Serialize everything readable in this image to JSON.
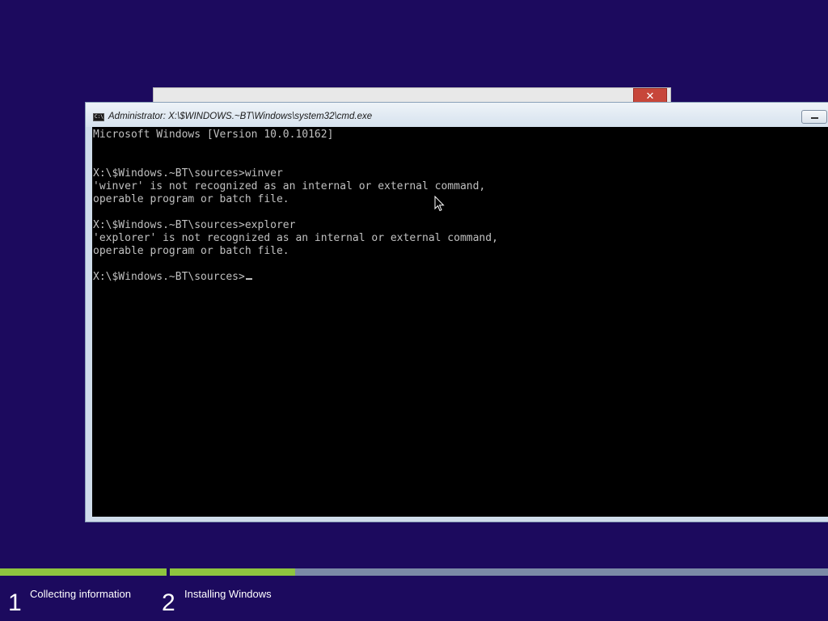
{
  "background_window": {
    "close_glyph": "✕"
  },
  "cmd_window": {
    "title": "Administrator: X:\\$WINDOWS.~BT\\Windows\\system32\\cmd.exe",
    "icon_text": "C:\\",
    "console_lines": [
      "Microsoft Windows [Version 10.0.10162]",
      "",
      "",
      "X:\\$Windows.~BT\\sources>winver",
      "'winver' is not recognized as an internal or external command,",
      "operable program or batch file.",
      "",
      "X:\\$Windows.~BT\\sources>explorer",
      "'explorer' is not recognized as an internal or external command,",
      "operable program or batch file.",
      "",
      "X:\\$Windows.~BT\\sources>"
    ]
  },
  "setup_progress": {
    "step1_progress": 1.0,
    "step2_progress": 0.19,
    "steps": [
      {
        "number": "1",
        "label": "Collecting information"
      },
      {
        "number": "2",
        "label": "Installing Windows"
      }
    ]
  },
  "colors": {
    "background": "#1c0a5e",
    "progress_done": "#8ec53f",
    "progress_pending": "#7b8aa6",
    "console_bg": "#000000",
    "console_text": "#c0c0c0"
  }
}
